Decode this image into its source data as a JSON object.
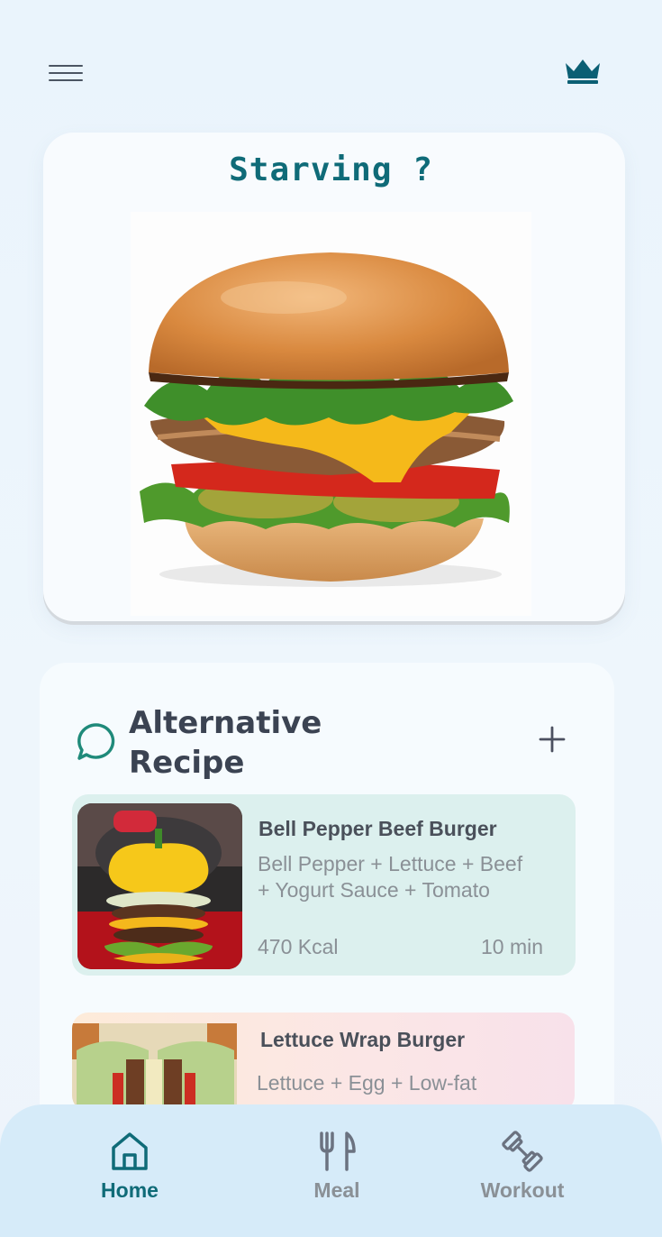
{
  "header": {
    "menu_icon": "hamburger-menu-icon",
    "premium_icon": "crown-icon",
    "colors": {
      "accent": "#0f6b78",
      "crown": "#0b5f74"
    }
  },
  "hero": {
    "title": "Starving ?",
    "image": "cheeseburger-photo"
  },
  "alternatives": {
    "title_line1": "Alternative",
    "title_line2": "Recipe",
    "icon": "chat-bubble-icon",
    "add_icon": "plus-icon",
    "recipes": [
      {
        "name": "Bell Pepper Beef Burger",
        "ingredients_line1": "Bell Pepper + Lettuce + Beef",
        "ingredients_line2": "+ Yogurt Sauce + Tomato",
        "kcal": "470 Kcal",
        "time": "10 min",
        "image": "bell-pepper-burger-photo"
      },
      {
        "name": "Lettuce Wrap Burger",
        "ingredients_line1": "Lettuce + Egg + Low-fat",
        "image": "lettuce-wrap-burger-photo"
      }
    ]
  },
  "nav": {
    "items": [
      {
        "label": "Home",
        "icon": "home-icon",
        "active": true
      },
      {
        "label": "Meal",
        "icon": "fork-knife-icon",
        "active": false
      },
      {
        "label": "Workout",
        "icon": "dumbbell-icon",
        "active": false
      }
    ],
    "colors": {
      "active": "#0f6b78",
      "inactive": "#8a9096"
    }
  }
}
